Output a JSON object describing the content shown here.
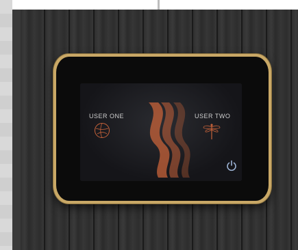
{
  "screen": {
    "user_one_label": "USER ONE",
    "user_two_label": "USER TWO"
  },
  "icons": {
    "user_one": "ball-icon",
    "center": "flame-waves-icon",
    "user_two": "dragonfly-icon",
    "power": "power-icon"
  },
  "colors": {
    "accent_orange": "#c8633a",
    "frame_gold": "#c9a866",
    "power_blue": "#9fb6d8"
  }
}
